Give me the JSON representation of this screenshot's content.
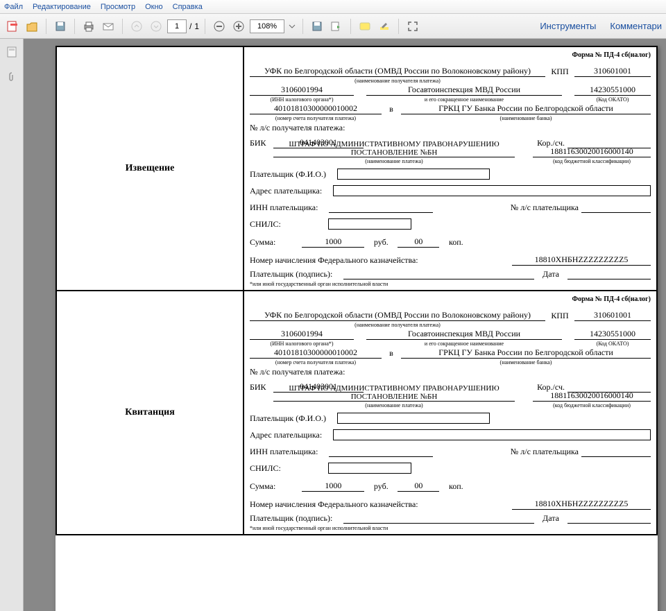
{
  "menu": {
    "file": "Файл",
    "edit": "Редактирование",
    "view": "Просмотр",
    "window": "Окно",
    "help": "Справка"
  },
  "toolbar": {
    "page_current": "1",
    "page_sep": "/",
    "page_total": "1",
    "zoom": "108%",
    "tools": "Инструменты",
    "comment": "Комментари"
  },
  "form": {
    "title_left_1": "Извещение",
    "title_left_2": "Квитанция",
    "form_no": "Форма № ПД-4 сб(налог)",
    "recipient": "УФК по Белгородской области (ОМВД России по Волоконовскому району)",
    "recipient_cap": "(наименование получателя платежа)",
    "kpp_lbl": "КПП",
    "kpp": "310601001",
    "inn": "3106001994",
    "inn_cap": "(ИНН налогового органа*)",
    "gai": "Госавтоинспекция МВД России",
    "gai_cap": "и его сокращенное наименование",
    "okato": "14230551000",
    "okato_cap": "(Код ОКАТО)",
    "account": "40101810300000010002",
    "account_cap": "(номер счета получателя платежа)",
    "v": "в",
    "bank": "ГРКЦ ГУ Банка России по Белгородской области",
    "bank_cap": "(наименование банка)",
    "ls_lbl": "№ л/с получателя платежа:",
    "bik_lbl": "БИК",
    "bik": "041403001",
    "kor_lbl": "Кор./сч.",
    "purpose": "ШТРАФ ПО АДМИНИСТРАТИВНОМУ ПРАВОНАРУШЕНИЮ ПОСТАНОВЛЕНИЕ №БН",
    "purpose_cap": "(наименование платежа)",
    "kbk": "18811630020016000140",
    "kbk_cap": "(код бюджетной классификации)",
    "payer_fio_lbl": "Плательщик (Ф.И.О.)",
    "payer_addr_lbl": "Адрес плательщика:",
    "payer_inn_lbl": "ИНН плательщика:",
    "payer_ls_lbl": "№ л/с плательщика",
    "snils_lbl": "СНИЛС:",
    "sum_lbl": "Сумма:",
    "sum_rub": "1000",
    "rub": "руб.",
    "sum_kop": "00",
    "kop": "коп.",
    "accrual_lbl": "Номер начисления Федерального казначейства:",
    "accrual": "18810ХНБНZZZZZZZZZ5",
    "sign_lbl": "Плательщик (подпись):",
    "date_lbl": "Дата",
    "footnote": "*или иной государственный орган исполнительной власти"
  }
}
